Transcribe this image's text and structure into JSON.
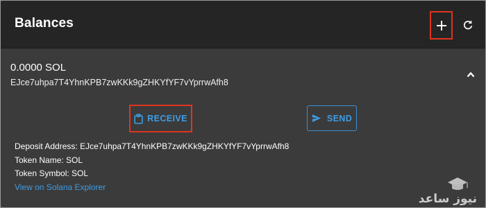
{
  "header": {
    "title": "Balances",
    "add_icon": "plus-icon",
    "refresh_icon": "refresh-icon"
  },
  "balance": {
    "amount": "0.0000 SOL",
    "address": "EJce7uhpa7T4YhnKPB7zwKKk9gZHKYfYF7vYprrwAfh8",
    "collapse_icon": "chevron-up-icon"
  },
  "actions": {
    "receive_label": "RECEIVE",
    "receive_icon": "clipboard-icon",
    "send_label": "SEND",
    "send_icon": "send-icon"
  },
  "details": {
    "deposit_address_label": "Deposit Address:",
    "deposit_address_value": "EJce7uhpa7T4YhnKPB7zwKKk9gZHKYfYF7vYprrwAfh8",
    "token_name_label": "Token Name:",
    "token_name_value": "SOL",
    "token_symbol_label": "Token Symbol:",
    "token_symbol_value": "SOL",
    "explorer_link": "View on Solana Explorer"
  },
  "watermark": {
    "text": "نیوز ساعد"
  },
  "colors": {
    "header_bg": "#252525",
    "panel_bg": "#3b3b3b",
    "accent_blue": "#3d9ce6",
    "highlight_red": "#e0341f"
  }
}
